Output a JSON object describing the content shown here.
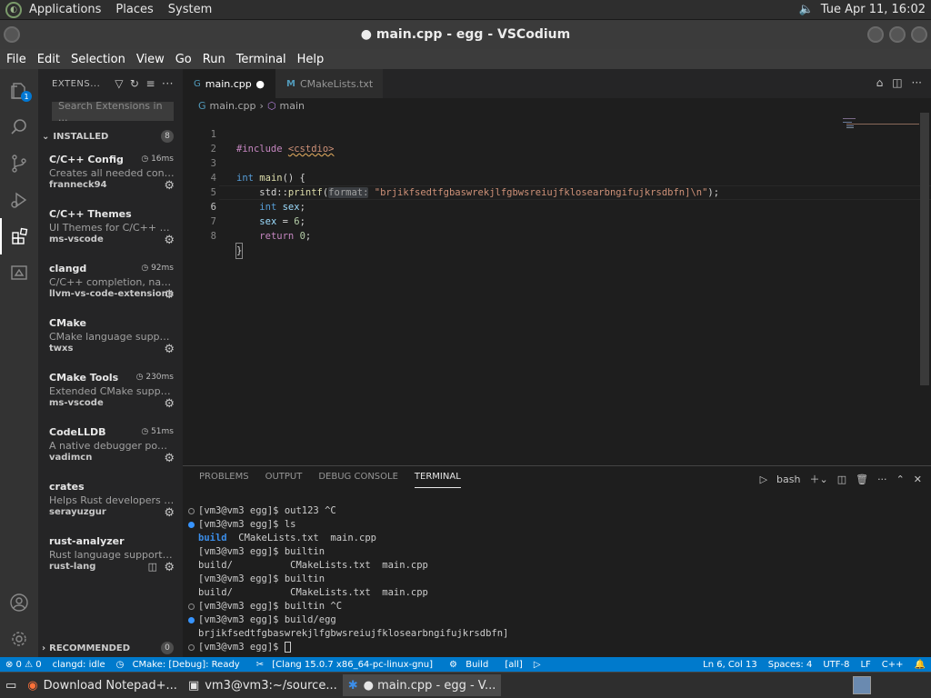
{
  "top_panel": {
    "menus": [
      "Applications",
      "Places",
      "System"
    ],
    "clock": "Tue Apr 11, 16:02"
  },
  "window": {
    "title": "● main.cpp - egg - VSCodium"
  },
  "menu_bar": [
    "File",
    "Edit",
    "Selection",
    "View",
    "Go",
    "Run",
    "Terminal",
    "Help"
  ],
  "activity_bar": {
    "explorer_badge": "1"
  },
  "sidebar": {
    "title": "EXTENS...",
    "search_placeholder": "Search Extensions in ...",
    "installed_label": "INSTALLED",
    "installed_count": "8",
    "recommended_label": "RECOMMENDED",
    "recommended_count": "0",
    "extensions": [
      {
        "name": "C/C++ Config",
        "time": "16ms",
        "desc": "Creates all needed config ...",
        "publisher": "franneck94"
      },
      {
        "name": "C/C++ Themes",
        "time": "",
        "desc": "UI Themes for C/C++ exte...",
        "publisher": "ms-vscode"
      },
      {
        "name": "clangd",
        "time": "92ms",
        "desc": "C/C++ completion, navigat...",
        "publisher": "llvm-vs-code-extensions"
      },
      {
        "name": "CMake",
        "time": "",
        "desc": "CMake language support f...",
        "publisher": "twxs"
      },
      {
        "name": "CMake Tools",
        "time": "230ms",
        "desc": "Extended CMake support i...",
        "publisher": "ms-vscode"
      },
      {
        "name": "CodeLLDB",
        "time": "51ms",
        "desc": "A native debugger powere...",
        "publisher": "vadimcn"
      },
      {
        "name": "crates",
        "time": "",
        "desc": "Helps Rust developers ma...",
        "publisher": "serayuzgur"
      },
      {
        "name": "rust-analyzer",
        "time": "",
        "desc": "Rust language support for...",
        "publisher": "rust-lang"
      }
    ]
  },
  "tabs": [
    {
      "label": "main.cpp",
      "modified": "●"
    },
    {
      "label": "CMakeLists.txt"
    }
  ],
  "breadcrumb": [
    "main.cpp",
    "main"
  ],
  "code": {
    "line_numbers": [
      "1",
      "2",
      "3",
      "4",
      "5",
      "6",
      "7",
      "8"
    ],
    "include_directive": "#include",
    "include_file": "<cstdio>",
    "l3_kw": "int",
    "l3_fn": "main",
    "l3_rest": "() {",
    "l4_ns": "std::",
    "l4_fn": "printf",
    "l4_hint": "format:",
    "l4_str": "\"brjikfsedtfgbaswrekjlfgbwsreiujfklosearbngifujkrsdbfn]\\n\"",
    "l4_end": ");",
    "l5_kw": "int",
    "l5_var": "sex",
    "l6_var": "sex",
    "l6_num": "6",
    "l7_kw": "return",
    "l7_num": "0",
    "l8": "}"
  },
  "panel": {
    "tabs": [
      "PROBLEMS",
      "OUTPUT",
      "DEBUG CONSOLE",
      "TERMINAL"
    ],
    "shell": "bash",
    "terminal": [
      {
        "dot": "grey",
        "text": "[vm3@vm3 egg]$ out123 ^C"
      },
      {
        "dot": "blue",
        "text": "[vm3@vm3 egg]$ ls"
      },
      {
        "dot": "",
        "dirs": "build",
        "text": "  CMakeLists.txt  main.cpp"
      },
      {
        "dot": "",
        "text": "[vm3@vm3 egg]$ builtin"
      },
      {
        "dot": "",
        "text": "build/          CMakeLists.txt  main.cpp"
      },
      {
        "dot": "",
        "text": "[vm3@vm3 egg]$ builtin"
      },
      {
        "dot": "",
        "text": "build/          CMakeLists.txt  main.cpp"
      },
      {
        "dot": "grey",
        "text": "[vm3@vm3 egg]$ builtin ^C"
      },
      {
        "dot": "blue",
        "text": "[vm3@vm3 egg]$ build/egg"
      },
      {
        "dot": "",
        "text": "brjikfsedtfgbaswrekjlfgbwsreiujfklosearbngifujkrsdbfn]"
      },
      {
        "dot": "grey",
        "text": "[vm3@vm3 egg]$ "
      }
    ]
  },
  "status_bar": {
    "problems": "⊗ 0 ⚠ 0",
    "clangd": "clangd: idle",
    "cmake": "CMake: [Debug]: Ready",
    "kit": "[Clang 15.0.7 x86_64-pc-linux-gnu]",
    "build": "Build",
    "target": "[all]",
    "position": "Ln 6, Col 13",
    "spaces": "Spaces: 4",
    "encoding": "UTF-8",
    "eol": "LF",
    "language": "C++"
  },
  "taskbar": [
    {
      "label": "Download Notepad+..."
    },
    {
      "label": "vm3@vm3:~/source..."
    },
    {
      "label": "● main.cpp - egg - V..."
    }
  ]
}
